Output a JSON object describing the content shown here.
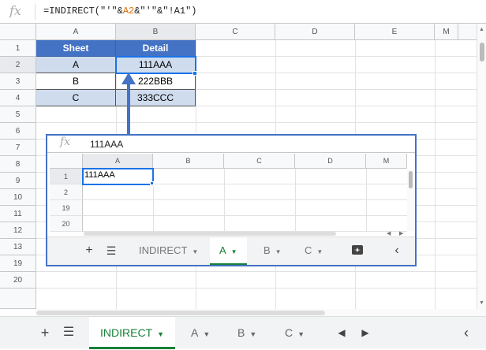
{
  "formula_bar": {
    "fx_icon": "fx",
    "formula_parts": [
      "=INDIRECT(\"'\"&",
      "A2",
      "&\"'\"&\"!",
      "A1",
      "\")"
    ]
  },
  "columns": [
    "A",
    "B",
    "C",
    "D",
    "E",
    "M"
  ],
  "rows": [
    "1",
    "2",
    "3",
    "4",
    "5",
    "6",
    "7",
    "8",
    "9",
    "10",
    "11",
    "12",
    "13",
    "19",
    "20"
  ],
  "table": {
    "headers": [
      "Sheet",
      "Detail"
    ],
    "rows": [
      [
        "A",
        "111AAA"
      ],
      [
        "B",
        "222BBB"
      ],
      [
        "C",
        "333CCC"
      ]
    ]
  },
  "inset": {
    "fx_icon": "fx",
    "cell_value": "111AAA",
    "columns": [
      "A",
      "B",
      "C",
      "D",
      "M"
    ],
    "rows": [
      "1",
      "2",
      "19",
      "20"
    ],
    "a1_value": "111AAA",
    "tabs": [
      {
        "label": "INDIRECT",
        "active": false
      },
      {
        "label": "A",
        "active": true
      },
      {
        "label": "B",
        "active": false
      },
      {
        "label": "C",
        "active": false
      }
    ]
  },
  "tabs": [
    {
      "label": "INDIRECT",
      "active": true
    },
    {
      "label": "A",
      "active": false
    },
    {
      "label": "B",
      "active": false
    },
    {
      "label": "C",
      "active": false
    }
  ],
  "colors": {
    "accent": "#4472c4",
    "active_tab": "#188038",
    "header_fill": "#4472c4",
    "row_fill": "#cfdcee"
  }
}
